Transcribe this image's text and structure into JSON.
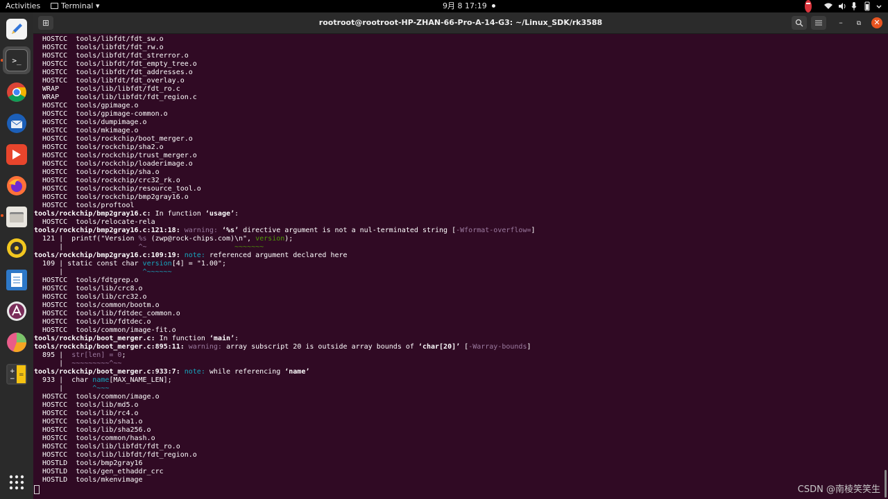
{
  "topbar": {
    "activities": "Activities",
    "app_menu": "Terminal",
    "clock": "9月 8  17:19",
    "tray_icons": [
      "do-not-disturb-icon",
      "wifi-icon",
      "volume-icon",
      "microphone-icon",
      "battery-icon",
      "power-menu-icon"
    ]
  },
  "dock": {
    "items": [
      "text-editor",
      "terminal",
      "chrome",
      "thunderbird",
      "wps-office",
      "firefox",
      "files",
      "rhythmbox",
      "libreoffice-writer",
      "app-center",
      "disk-usage",
      "calculator"
    ],
    "show_apps": "show-applications"
  },
  "window": {
    "title": "rootroot@rootroot-HP-ZHAN-66-Pro-A-14-G3: ~/Linux_SDK/rk3588"
  },
  "terminal": {
    "lines": [
      [
        {
          "t": "  HOSTCC  tools/libfdt/fdt_sw.o"
        }
      ],
      [
        {
          "t": "  HOSTCC  tools/libfdt/fdt_rw.o"
        }
      ],
      [
        {
          "t": "  HOSTCC  tools/libfdt/fdt_strerror.o"
        }
      ],
      [
        {
          "t": "  HOSTCC  tools/libfdt/fdt_empty_tree.o"
        }
      ],
      [
        {
          "t": "  HOSTCC  tools/libfdt/fdt_addresses.o"
        }
      ],
      [
        {
          "t": "  HOSTCC  tools/libfdt/fdt_overlay.o"
        }
      ],
      [
        {
          "t": "  WRAP    tools/lib/libfdt/fdt_ro.c"
        }
      ],
      [
        {
          "t": "  WRAP    tools/lib/libfdt/fdt_region.c"
        }
      ],
      [
        {
          "t": "  HOSTCC  tools/gpimage.o"
        }
      ],
      [
        {
          "t": "  HOSTCC  tools/gpimage-common.o"
        }
      ],
      [
        {
          "t": "  HOSTCC  tools/dumpimage.o"
        }
      ],
      [
        {
          "t": "  HOSTCC  tools/mkimage.o"
        }
      ],
      [
        {
          "t": "  HOSTCC  tools/rockchip/boot_merger.o"
        }
      ],
      [
        {
          "t": "  HOSTCC  tools/rockchip/sha2.o"
        }
      ],
      [
        {
          "t": "  HOSTCC  tools/rockchip/trust_merger.o"
        }
      ],
      [
        {
          "t": "  HOSTCC  tools/rockchip/loaderimage.o"
        }
      ],
      [
        {
          "t": "  HOSTCC  tools/rockchip/sha.o"
        }
      ],
      [
        {
          "t": "  HOSTCC  tools/rockchip/crc32_rk.o"
        }
      ],
      [
        {
          "t": "  HOSTCC  tools/rockchip/resource_tool.o"
        }
      ],
      [
        {
          "t": "  HOSTCC  tools/rockchip/bmp2gray16.o"
        }
      ],
      [
        {
          "t": "  HOSTCC  tools/proftool"
        }
      ],
      [
        {
          "t": "tools/rockchip/bmp2gray16.c:",
          "c": "b"
        },
        {
          "t": " In function "
        },
        {
          "t": "‘usage’",
          "c": "b"
        },
        {
          "t": ":"
        }
      ],
      [
        {
          "t": "  HOSTCC  tools/relocate-rela"
        }
      ],
      [
        {
          "t": "tools/rockchip/bmp2gray16.c:121:18:",
          "c": "b"
        },
        {
          "t": " "
        },
        {
          "t": "warning:",
          "c": "purple"
        },
        {
          "t": " "
        },
        {
          "t": "‘%s’",
          "c": "b"
        },
        {
          "t": " directive argument is not a nul-terminated string ["
        },
        {
          "t": "-Wformat-overflow=",
          "c": "purple"
        },
        {
          "t": "]"
        }
      ],
      [
        {
          "t": "  121 |  printf(\"Version "
        },
        {
          "t": "%s",
          "c": "purple"
        },
        {
          "t": " (zwp@rock-chips.com)\\n\", "
        },
        {
          "t": "version",
          "c": "grn"
        },
        {
          "t": ");"
        }
      ],
      [
        {
          "t": "      |                  "
        },
        {
          "t": "^~",
          "c": "purple"
        },
        {
          "t": "                     "
        },
        {
          "t": "~~~~~~~",
          "c": "grn"
        }
      ],
      [
        {
          "t": "tools/rockchip/bmp2gray16.c:109:19:",
          "c": "b"
        },
        {
          "t": " "
        },
        {
          "t": "note:",
          "c": "teal"
        },
        {
          "t": " referenced argument declared here"
        }
      ],
      [
        {
          "t": "  109 | static const char "
        },
        {
          "t": "version",
          "c": "teal"
        },
        {
          "t": "[4] = \"1.00\";"
        }
      ],
      [
        {
          "t": "      |                   "
        },
        {
          "t": "^~~~~~~",
          "c": "teal"
        }
      ],
      [
        {
          "t": "  HOSTCC  tools/fdtgrep.o"
        }
      ],
      [
        {
          "t": "  HOSTCC  tools/lib/crc8.o"
        }
      ],
      [
        {
          "t": "  HOSTCC  tools/lib/crc32.o"
        }
      ],
      [
        {
          "t": "  HOSTCC  tools/common/bootm.o"
        }
      ],
      [
        {
          "t": "  HOSTCC  tools/lib/fdtdec_common.o"
        }
      ],
      [
        {
          "t": "  HOSTCC  tools/lib/fdtdec.o"
        }
      ],
      [
        {
          "t": "  HOSTCC  tools/common/image-fit.o"
        }
      ],
      [
        {
          "t": "tools/rockchip/boot_merger.c:",
          "c": "b"
        },
        {
          "t": " In function "
        },
        {
          "t": "‘main’",
          "c": "b"
        },
        {
          "t": ":"
        }
      ],
      [
        {
          "t": "tools/rockchip/boot_merger.c:895:11:",
          "c": "b"
        },
        {
          "t": " "
        },
        {
          "t": "warning:",
          "c": "purple"
        },
        {
          "t": " array subscript 20 is outside array bounds of "
        },
        {
          "t": "‘char[20]’",
          "c": "b"
        },
        {
          "t": " ["
        },
        {
          "t": "-Warray-bounds",
          "c": "purple"
        },
        {
          "t": "]"
        }
      ],
      [
        {
          "t": "  895 |  "
        },
        {
          "t": "str[len] = 0",
          "c": "purple"
        },
        {
          "t": ";"
        }
      ],
      [
        {
          "t": "      |  "
        },
        {
          "t": "~~~~~~~~~^~~",
          "c": "purple"
        }
      ],
      [
        {
          "t": "tools/rockchip/boot_merger.c:933:7:",
          "c": "b"
        },
        {
          "t": " "
        },
        {
          "t": "note:",
          "c": "teal"
        },
        {
          "t": " while referencing "
        },
        {
          "t": "‘name’",
          "c": "b"
        }
      ],
      [
        {
          "t": "  933 |  char "
        },
        {
          "t": "name",
          "c": "teal"
        },
        {
          "t": "[MAX_NAME_LEN];"
        }
      ],
      [
        {
          "t": "      |       "
        },
        {
          "t": "^~~~",
          "c": "teal"
        }
      ],
      [
        {
          "t": "  HOSTCC  tools/common/image.o"
        }
      ],
      [
        {
          "t": "  HOSTCC  tools/lib/md5.o"
        }
      ],
      [
        {
          "t": "  HOSTCC  tools/lib/rc4.o"
        }
      ],
      [
        {
          "t": "  HOSTCC  tools/lib/sha1.o"
        }
      ],
      [
        {
          "t": "  HOSTCC  tools/lib/sha256.o"
        }
      ],
      [
        {
          "t": "  HOSTCC  tools/common/hash.o"
        }
      ],
      [
        {
          "t": "  HOSTCC  tools/lib/libfdt/fdt_ro.o"
        }
      ],
      [
        {
          "t": "  HOSTCC  tools/lib/libfdt/fdt_region.o"
        }
      ],
      [
        {
          "t": "  HOSTLD  tools/bmp2gray16"
        }
      ],
      [
        {
          "t": "  HOSTLD  tools/gen_ethaddr_crc"
        }
      ],
      [
        {
          "t": "  HOSTLD  tools/mkenvimage"
        }
      ]
    ]
  },
  "watermark": "CSDN @南棱笑笑生"
}
